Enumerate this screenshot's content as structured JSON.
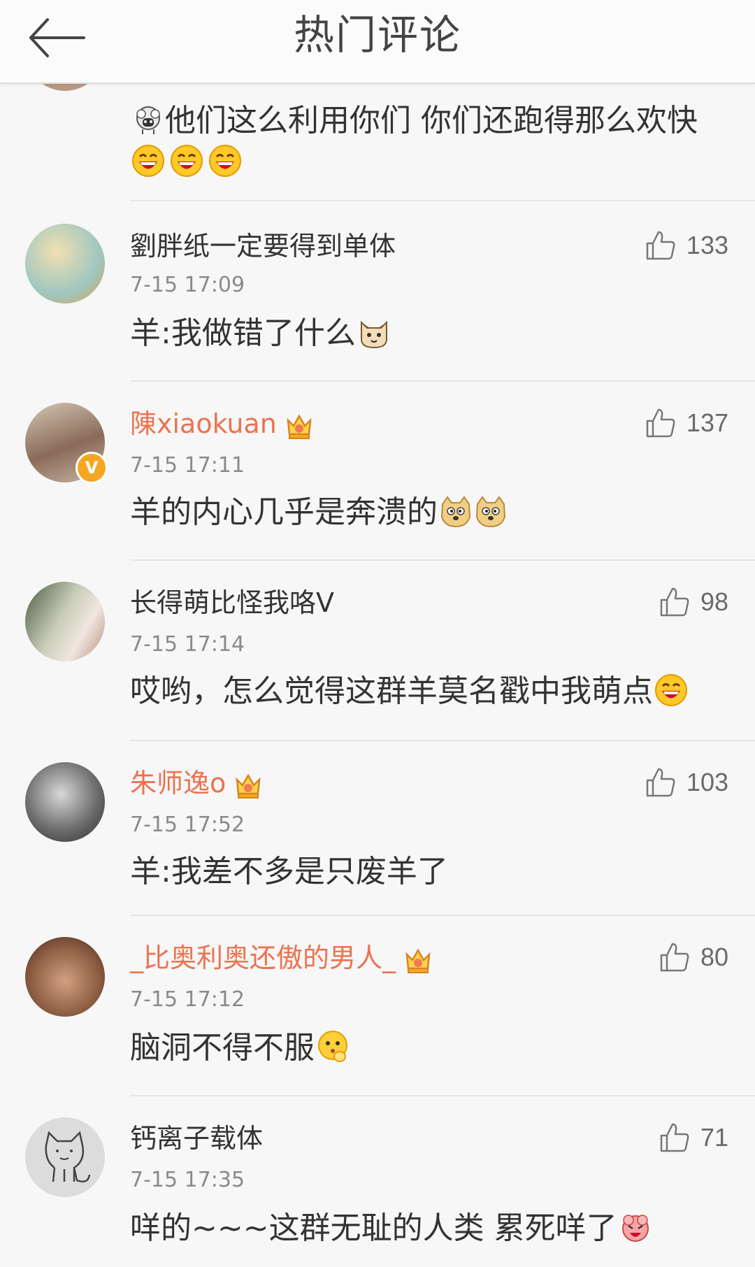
{
  "header": {
    "title": "热门评论",
    "back_icon": "arrow-left-icon"
  },
  "partial_comment": {
    "text": "他们这么利用你们  你们还跑得那么欢快"
  },
  "comments": [
    {
      "username": "劉胖纸一定要得到单体",
      "time": "7-15 17:09",
      "likes": "133",
      "text": "羊:我做错了什么",
      "vip": false,
      "verified": false
    },
    {
      "username": "陳xiaokuan",
      "time": "7-15 17:11",
      "likes": "137",
      "text": "羊的内心几乎是奔溃的",
      "vip": true,
      "verified": true
    },
    {
      "username": "长得萌比怪我咯V",
      "time": "7-15 17:14",
      "likes": "98",
      "text": "哎哟，怎么觉得这群羊莫名戳中我萌点",
      "vip": false,
      "verified": false
    },
    {
      "username": "朱师逸o",
      "time": "7-15 17:52",
      "likes": "103",
      "text": "羊:我差不多是只废羊了",
      "vip": true,
      "verified": false
    },
    {
      "username": "_比奥利奥还傲的男人_",
      "time": "7-15 17:12",
      "likes": "80",
      "text": "脑洞不得不服",
      "vip": true,
      "verified": false
    },
    {
      "username": "钙离子载体",
      "time": "7-15 17:35",
      "likes": "71",
      "text": "咩的~~~这群无耻的人类   累死咩了",
      "vip": false,
      "verified": false
    }
  ],
  "colors": {
    "vip_name": "#eb7350",
    "badge": "#f5a623",
    "text": "#333333",
    "time": "#8a8a8a"
  }
}
